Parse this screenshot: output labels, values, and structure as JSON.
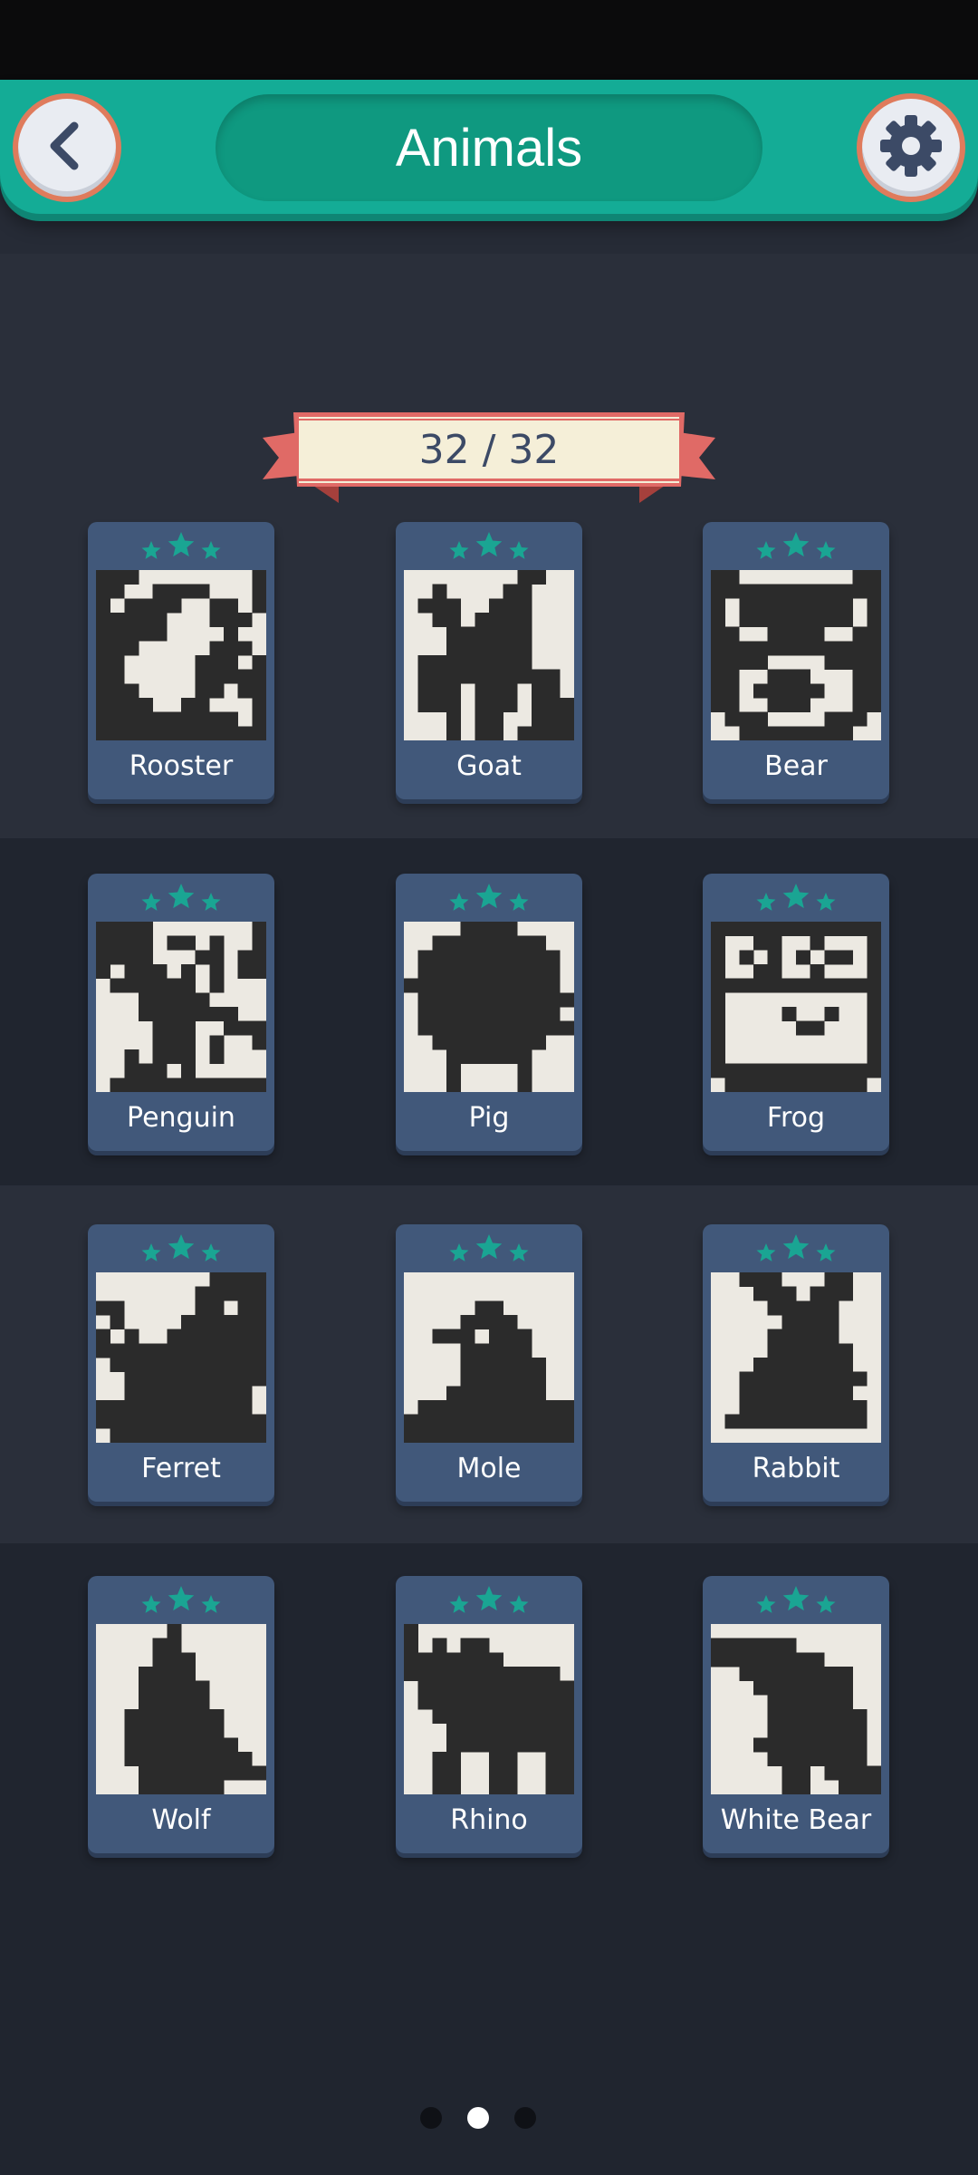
{
  "header": {
    "title": "Animals",
    "back_icon": "chevron-left-icon",
    "settings_icon": "gear-icon",
    "accent_color": "#14ac96",
    "button_ring_color": "#df7b5c"
  },
  "progress": {
    "label": "32 / 32",
    "completed": 32,
    "total": 32
  },
  "puzzles": [
    {
      "name": "Rooster",
      "stars": 3
    },
    {
      "name": "Goat",
      "stars": 3
    },
    {
      "name": "Bear",
      "stars": 3
    },
    {
      "name": "Penguin",
      "stars": 3
    },
    {
      "name": "Pig",
      "stars": 3
    },
    {
      "name": "Frog",
      "stars": 3
    },
    {
      "name": "Ferret",
      "stars": 3
    },
    {
      "name": "Mole",
      "stars": 3
    },
    {
      "name": "Rabbit",
      "stars": 3
    },
    {
      "name": "Wolf",
      "stars": 3
    },
    {
      "name": "Rhino",
      "stars": 3
    },
    {
      "name": "White Bear",
      "stars": 3
    }
  ],
  "pagination": {
    "pages": 3,
    "current": 2
  },
  "colors": {
    "star": "#1aa593",
    "card": "#41587a",
    "pixel_dark": "#2b2b2b",
    "pixel_light": "#ece9e2"
  }
}
